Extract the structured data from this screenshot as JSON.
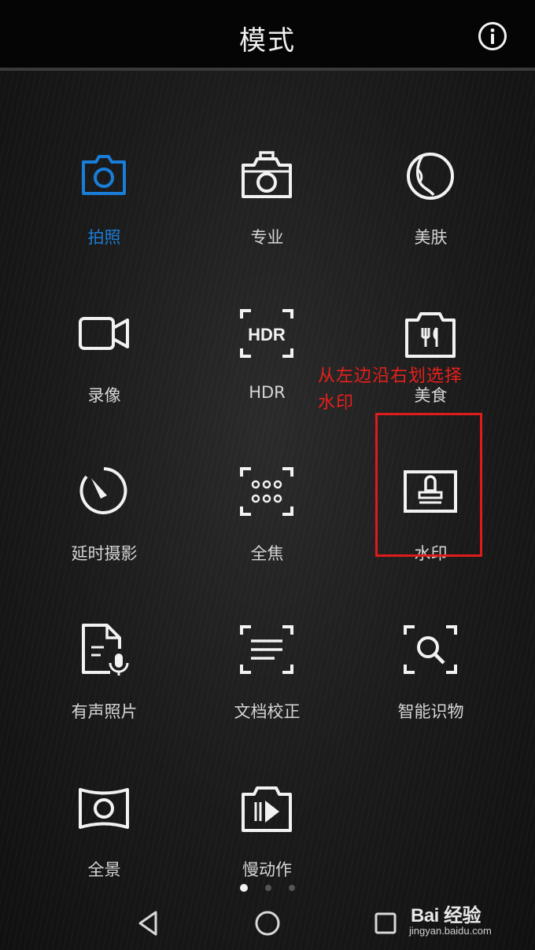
{
  "header": {
    "title": "模式"
  },
  "modes": [
    {
      "label": "拍照",
      "icon": "camera-icon",
      "active": true
    },
    {
      "label": "专业",
      "icon": "pro-camera-icon",
      "active": false
    },
    {
      "label": "美肤",
      "icon": "face-beauty-icon",
      "active": false
    },
    {
      "label": "录像",
      "icon": "video-camera-icon",
      "active": false
    },
    {
      "label": "HDR",
      "icon": "hdr-icon",
      "active": false
    },
    {
      "label": "美食",
      "icon": "food-icon",
      "active": false
    },
    {
      "label": "延时摄影",
      "icon": "timelapse-icon",
      "active": false
    },
    {
      "label": "全焦",
      "icon": "all-focus-icon",
      "active": false
    },
    {
      "label": "水印",
      "icon": "watermark-stamp-icon",
      "active": false
    },
    {
      "label": "有声照片",
      "icon": "audio-photo-icon",
      "active": false
    },
    {
      "label": "文档校正",
      "icon": "document-correction-icon",
      "active": false
    },
    {
      "label": "智能识物",
      "icon": "object-recognition-icon",
      "active": false
    },
    {
      "label": "全景",
      "icon": "panorama-icon",
      "active": false
    },
    {
      "label": "慢动作",
      "icon": "slow-motion-icon",
      "active": false
    }
  ],
  "annotation": {
    "line1": "从左边沿右划选择",
    "line2": "水印"
  },
  "pagination": {
    "current": 1,
    "total": 3
  },
  "watermark": {
    "brand": "Bai 经验",
    "url": "jingyan.baidu.com"
  },
  "colors": {
    "accent": "#1a7dd8",
    "annotation": "#e8201c",
    "icon": "#f2f2f2"
  }
}
